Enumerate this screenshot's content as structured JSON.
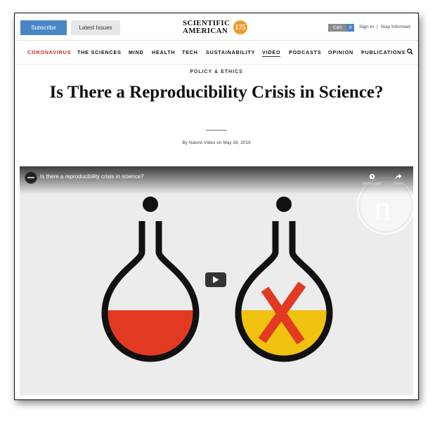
{
  "header": {
    "subscribe_label": "Subscribe",
    "latest_issues_label": "Latest Issues",
    "logo_line1": "SCIENTIFIC",
    "logo_line2": "AMERICAN",
    "logo_badge": "175",
    "cart_label": "Cart",
    "cart_count": "0",
    "sign_in": "Sign In",
    "divider": "|",
    "stay_informed": "Stay Informed"
  },
  "nav": {
    "items": [
      "CORONAVIRUS",
      "THE SCIENCES",
      "MIND",
      "HEALTH",
      "TECH",
      "SUSTAINABILITY",
      "VIDEO",
      "PODCASTS",
      "OPINION",
      "PUBLICATIONS"
    ],
    "active": "VIDEO",
    "highlight": "CORONAVIRUS",
    "search_icon": "search-icon"
  },
  "article": {
    "kicker": "POLICY & ETHICS",
    "title": "Is There a Reproducibility Crisis in Science?",
    "byline": "By Nature Video on May 28, 2016"
  },
  "video": {
    "title": "Is there a reproducibility crisis in science?",
    "watch_later": "Watch later",
    "share": "Share",
    "watermark": "n",
    "icons": [
      "channel-icon",
      "clock-icon",
      "share-icon",
      "play-icon"
    ]
  },
  "colors": {
    "subscribe": "#4a86c5",
    "accent_red": "#c62828",
    "logo_badge": "#f29a2e",
    "flask_red": "#e23a22",
    "flask_yellow": "#f0c10f",
    "cross_red": "#e23a22"
  }
}
